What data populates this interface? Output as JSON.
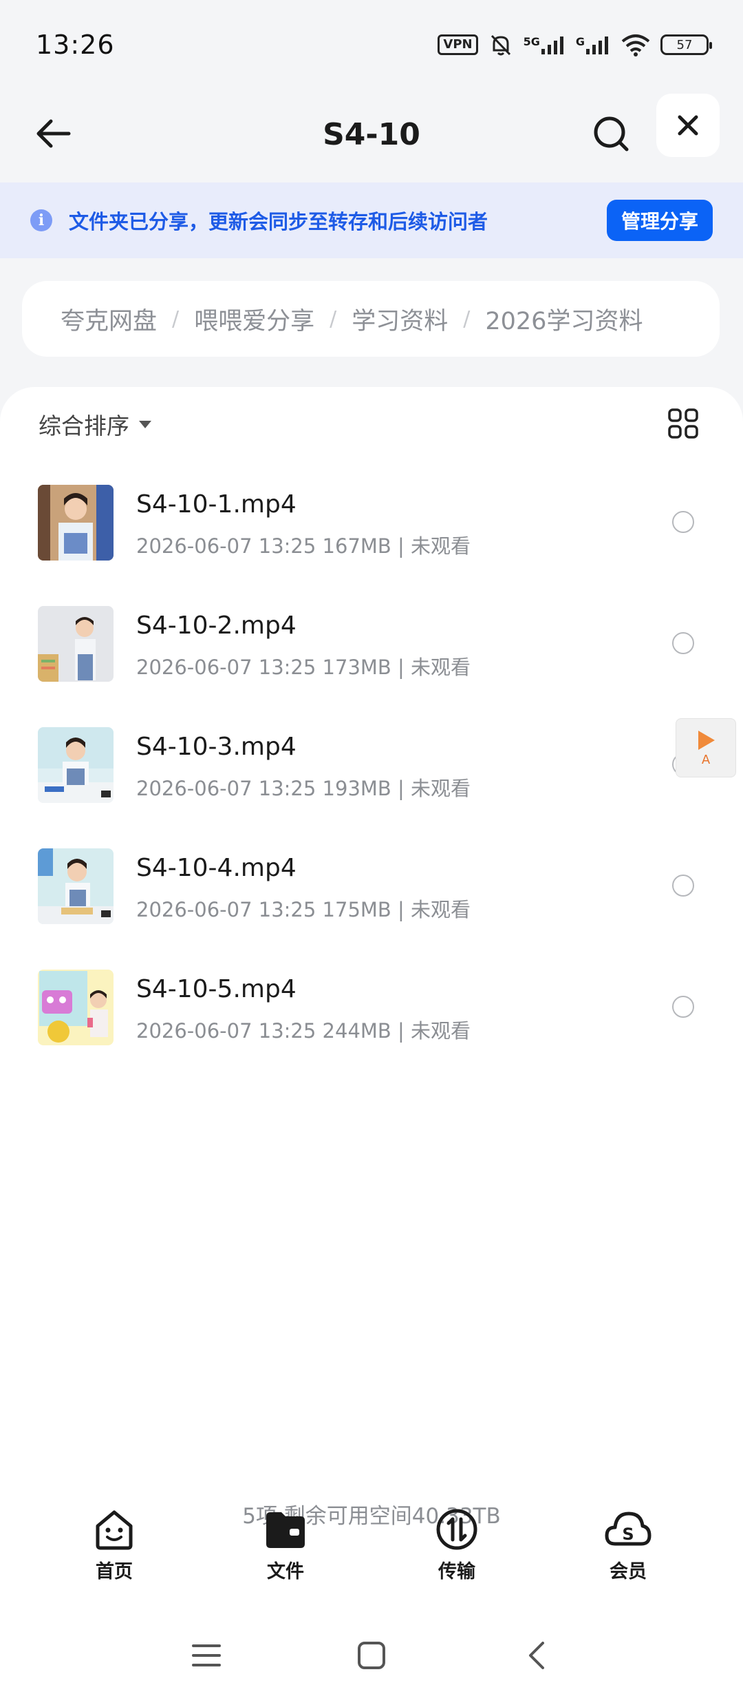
{
  "status": {
    "time": "13:26",
    "vpn": "VPN",
    "net_5g": "5G",
    "net_g": "G",
    "battery": "57"
  },
  "header": {
    "title": "S4-10"
  },
  "banner": {
    "text": "文件夹已分享，更新会同步至转存和后续访问者",
    "button": "管理分享"
  },
  "breadcrumb": [
    "夸克网盘",
    "喂喂爱分享",
    "学习资料",
    "2026学习资料"
  ],
  "sort": {
    "label": "综合排序"
  },
  "files": [
    {
      "name": "S4-10-1.mp4",
      "meta": "2026-06-07 13:25  167MB | 未观看"
    },
    {
      "name": "S4-10-2.mp4",
      "meta": "2026-06-07 13:25  173MB | 未观看"
    },
    {
      "name": "S4-10-3.mp4",
      "meta": "2026-06-07 13:25  193MB | 未观看"
    },
    {
      "name": "S4-10-4.mp4",
      "meta": "2026-06-07 13:25  175MB | 未观看"
    },
    {
      "name": "S4-10-5.mp4",
      "meta": "2026-06-07 13:25  244MB | 未观看"
    }
  ],
  "floating_player": {
    "label": "A"
  },
  "footer": {
    "info": "5项 剩余可用空间40.33TB"
  },
  "tabs": [
    {
      "label": "首页",
      "icon": "smile-home-icon"
    },
    {
      "label": "文件",
      "icon": "folder-icon"
    },
    {
      "label": "传输",
      "icon": "transfer-icon"
    },
    {
      "label": "会员",
      "icon": "member-cloud-icon"
    }
  ],
  "colors": {
    "accent": "#0b63f6",
    "banner_bg": "#e8ecfb",
    "banner_text": "#1e5be6"
  }
}
